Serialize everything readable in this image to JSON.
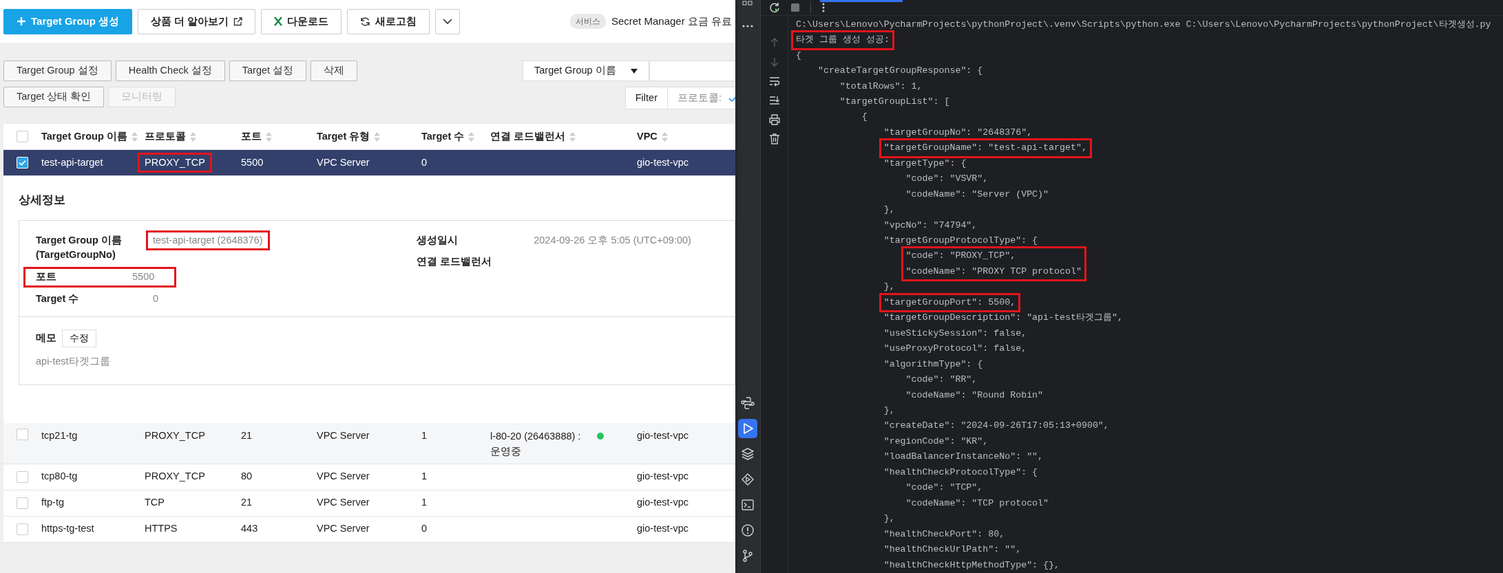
{
  "toolbar": {
    "buttons": [
      {
        "kind": "primary",
        "label": "Target Group 생성"
      },
      {
        "kind": "external",
        "label": "상품 더 알아보기"
      },
      {
        "kind": "excel",
        "label": "다운로드"
      },
      {
        "kind": "refresh",
        "label": "새로고침"
      },
      {
        "kind": "more"
      }
    ],
    "notice": {
      "badge": "서비스",
      "text": "Secret Manager 요금 유료"
    }
  },
  "action_rows": [
    [
      {
        "label": "Target Group 설정",
        "disabled": false
      },
      {
        "label": "Health Check 설정",
        "disabled": false
      },
      {
        "label": "Target 설정",
        "disabled": false
      },
      {
        "label": "삭제",
        "disabled": false
      }
    ],
    [
      {
        "label": "Target 상태 확인",
        "disabled": false
      },
      {
        "label": "모니터링",
        "disabled": true
      }
    ]
  ],
  "search": {
    "field": "Target Group 이름"
  },
  "filter": {
    "label": "Filter",
    "field": "프로토콜:"
  },
  "table": {
    "header_checked": false,
    "columns": [
      "Target Group 이름",
      "프로토콜",
      "포트",
      "Target 유형",
      "Target 수",
      "연결 로드밸런서",
      "VPC"
    ],
    "rows": [
      {
        "selected": true,
        "cells": [
          "test-api-target",
          "PROXY_TCP",
          "5500",
          "VPC Server",
          "0",
          "gio-test-vpc"
        ],
        "highlight": [
          false,
          true,
          false,
          false,
          false,
          false
        ]
      },
      {
        "selected": false,
        "cells": [
          "tcp21-tg",
          "PROXY_TCP",
          "21",
          "VPC Server",
          "1",
          "gio-test-vpc"
        ],
        "highlight": [
          false,
          false,
          false,
          false,
          false,
          false
        ],
        "lb": {
          "text": "l-80-20 (26463888) :",
          "status": "운영중",
          "color": "#22c55e"
        }
      },
      {
        "selected": false,
        "cells": [
          "tcp80-tg",
          "PROXY_TCP",
          "80",
          "VPC Server",
          "1",
          "gio-test-vpc"
        ],
        "highlight": [
          false,
          false,
          false,
          false,
          false,
          false
        ]
      },
      {
        "selected": false,
        "cells": [
          "ftp-tg",
          "TCP",
          "21",
          "VPC Server",
          "1",
          "gio-test-vpc"
        ],
        "highlight": [
          false,
          false,
          false,
          false,
          false,
          false
        ]
      },
      {
        "selected": false,
        "cells": [
          "https-tg-test",
          "HTTPS",
          "443",
          "VPC Server",
          "0",
          "gio-test-vpc"
        ],
        "highlight": [
          false,
          false,
          false,
          false,
          false,
          false
        ]
      }
    ]
  },
  "details": {
    "title": "상세정보",
    "left": [
      {
        "label": "Target Group 이름\n(TargetGroupNo)",
        "value": "test-api-target (2648376)",
        "value_highlighted": true,
        "row_highlighted": false
      },
      {
        "label": "포트",
        "value": "5500",
        "row_highlighted": true
      },
      {
        "label": "Target 수",
        "value": "0",
        "value_highlighted": false,
        "row_highlighted": false
      }
    ],
    "right": [
      {
        "label": "생성일시",
        "value": "2024-09-26 오후 5:05 (UTC+09:00)"
      },
      {
        "label": "연결 로드밸런서"
      }
    ],
    "memo": {
      "label": "메모",
      "button": "수정",
      "text": "api-test타겟그룹"
    }
  },
  "ide": {
    "tool_strip": [
      {
        "kind": "python",
        "selected": false
      },
      {
        "kind": "run",
        "selected": true
      },
      {
        "kind": "layers",
        "selected": false
      },
      {
        "kind": "services",
        "selected": false
      },
      {
        "kind": "terminal",
        "selected": false
      },
      {
        "kind": "problems",
        "selected": false
      },
      {
        "kind": "git",
        "selected": false
      }
    ],
    "console_lines": [
      {
        "text": "C:\\Users\\Lenovo\\PycharmProjects\\pythonProject\\.venv\\Scripts\\python.exe C:\\Users\\Lenovo\\PycharmProjects\\pythonProject\\타겟생성.py",
        "highlight": false
      },
      {
        "text": "타겟 그룹 생성 성공:",
        "highlight": true
      },
      {
        "text": "{",
        "highlight": false
      },
      {
        "text": "    \"createTargetGroupResponse\": {",
        "highlight": false
      },
      {
        "text": "        \"totalRows\": 1,",
        "highlight": false
      },
      {
        "text": "        \"targetGroupList\": [",
        "highlight": false
      },
      {
        "text": "            {",
        "highlight": false
      },
      {
        "text": "                \"targetGroupNo\": \"2648376\",",
        "highlight": false
      },
      {
        "text": "                \"targetGroupName\": \"test-api-target\",",
        "highlight": true
      },
      {
        "text": "                \"targetType\": {",
        "highlight": false
      },
      {
        "text": "                    \"code\": \"VSVR\",",
        "highlight": false
      },
      {
        "text": "                    \"codeName\": \"Server (VPC)\"",
        "highlight": false
      },
      {
        "text": "                },",
        "highlight": false
      },
      {
        "text": "                \"vpcNo\": \"74794\",",
        "highlight": false
      },
      {
        "text": "                \"targetGroupProtocolType\": {",
        "highlight": false
      },
      {
        "text": "                    \"code\": \"PROXY_TCP\",",
        "highlight": true
      },
      {
        "text": "                    \"codeName\": \"PROXY TCP protocol\"",
        "highlight": true
      },
      {
        "text": "                },",
        "highlight": false
      },
      {
        "text": "                \"targetGroupPort\": 5500,",
        "highlight": true
      },
      {
        "text": "                \"targetGroupDescription\": \"api-test타겟그룹\",",
        "highlight": false
      },
      {
        "text": "                \"useStickySession\": false,",
        "highlight": false
      },
      {
        "text": "                \"useProxyProtocol\": false,",
        "highlight": false
      },
      {
        "text": "                \"algorithmType\": {",
        "highlight": false
      },
      {
        "text": "                    \"code\": \"RR\",",
        "highlight": false
      },
      {
        "text": "                    \"codeName\": \"Round Robin\"",
        "highlight": false
      },
      {
        "text": "                },",
        "highlight": false
      },
      {
        "text": "                \"createDate\": \"2024-09-26T17:05:13+0900\",",
        "highlight": false
      },
      {
        "text": "                \"regionCode\": \"KR\",",
        "highlight": false
      },
      {
        "text": "                \"loadBalancerInstanceNo\": \"\",",
        "highlight": false
      },
      {
        "text": "                \"healthCheckProtocolType\": {",
        "highlight": false
      },
      {
        "text": "                    \"code\": \"TCP\",",
        "highlight": false
      },
      {
        "text": "                    \"codeName\": \"TCP protocol\"",
        "highlight": false
      },
      {
        "text": "                },",
        "highlight": false
      },
      {
        "text": "                \"healthCheckPort\": 80,",
        "highlight": false
      },
      {
        "text": "                \"healthCheckUrlPath\": \"\",",
        "highlight": false
      },
      {
        "text": "                \"healthCheckHttpMethodType\": {},",
        "highlight": false
      }
    ]
  }
}
